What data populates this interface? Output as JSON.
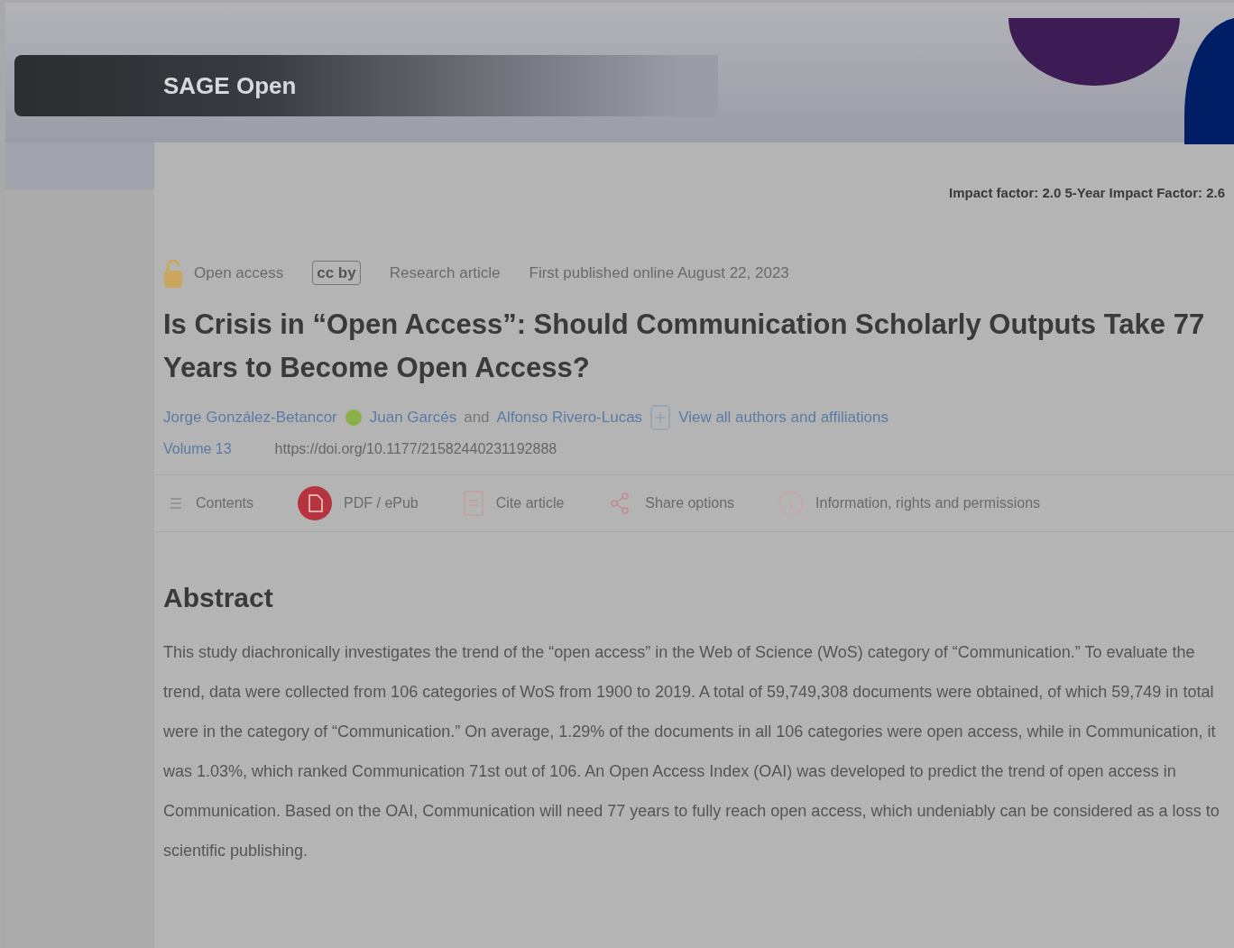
{
  "header": {
    "journal": "SAGE Open",
    "impact": "Impact factor: 2.0 5-Year Impact Factor: 2.6"
  },
  "meta": {
    "access": "Open access",
    "license": "cc by",
    "type": "Research article",
    "published": "First published online August 22, 2023"
  },
  "title": "Is Crisis in “Open Access”: Should Communication Scholarly Outputs Take 77 Years to Become Open Access?",
  "authors": [
    {
      "name": "Jorge González-Betancor",
      "orcid": true
    },
    {
      "name": "Juan Garcés",
      "orcid": false
    },
    {
      "name": "Alfonso Rivero-Lucas",
      "orcid": false
    }
  ],
  "authors_more": "and",
  "view_all": "View all authors and affiliations",
  "volume": "Volume 13",
  "doi": "https://doi.org/10.1177/21582440231192888",
  "tabs": [
    {
      "label": "Contents",
      "kind": "list",
      "selected": false
    },
    {
      "label": "PDF / ePub",
      "kind": "pdf",
      "selected": false
    },
    {
      "label": "Cite article",
      "kind": "quote",
      "selected": false
    },
    {
      "label": "Share options",
      "kind": "share",
      "selected": false
    },
    {
      "label": "Information, rights and permissions",
      "kind": "info",
      "selected": false
    }
  ],
  "abstract": {
    "heading": "Abstract",
    "text": "This study diachronically investigates the trend of the “open access” in the Web of Science (WoS) category of “Communication.” To evaluate the trend, data were collected from 106 categories of WoS from 1900 to 2019. A total of 59,749,308 documents were obtained, of which 59,749 in total were in the category of “Communication.” On average, 1.29% of the documents in all 106 categories were open access, while in Communication, it was 1.03%, which ranked Communication 71st out of 106. An Open Access Index (OAI) was developed to predict the trend of open access in Communication. Based on the OAI, Communication will need 77 years to fully reach open access, which undeniably can be considered as a loss to scientific publishing."
  }
}
